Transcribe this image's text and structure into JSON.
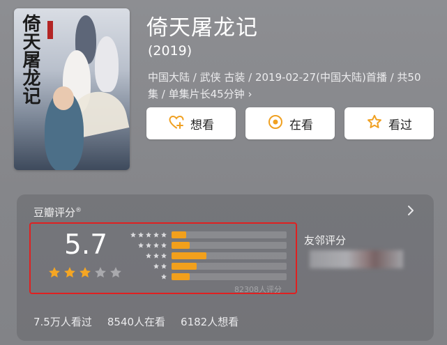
{
  "movie": {
    "title": "倚天屠龙记",
    "year": "(2019)",
    "meta_line1": "中国大陆 / 武侠 古装 / 2019-02-27(中国大陆)首播 / 共50",
    "meta_line2": "集 / 单集片长45分钟 ›",
    "poster_title": "倚天屠龙记"
  },
  "actions": [
    {
      "label": "想看",
      "icon": "heart-plus-icon"
    },
    {
      "label": "在看",
      "icon": "target-icon"
    },
    {
      "label": "看过",
      "icon": "star-outline-icon"
    }
  ],
  "rating": {
    "header": "豆瓣评分",
    "header_mark": "®",
    "score": "5.7",
    "stars_filled": 3,
    "stars_total": 5,
    "distribution": [
      {
        "stars": 5,
        "fraction": 0.13
      },
      {
        "stars": 4,
        "fraction": 0.16
      },
      {
        "stars": 3,
        "fraction": 0.3
      },
      {
        "stars": 2,
        "fraction": 0.22
      },
      {
        "stars": 1,
        "fraction": 0.16
      }
    ],
    "total": "82308人评分",
    "friends_label": "友邻评分"
  },
  "stats": {
    "watched": "7.5万人看过",
    "watching": "8540人在看",
    "want": "6182人想看"
  },
  "colors": {
    "background": "#87888c",
    "bar_fill": "#f2a01c",
    "star_filled": "#f5a623",
    "star_empty": "#a9a9ad",
    "highlight_border": "#e02020",
    "accent_icon": "#f0a020"
  }
}
